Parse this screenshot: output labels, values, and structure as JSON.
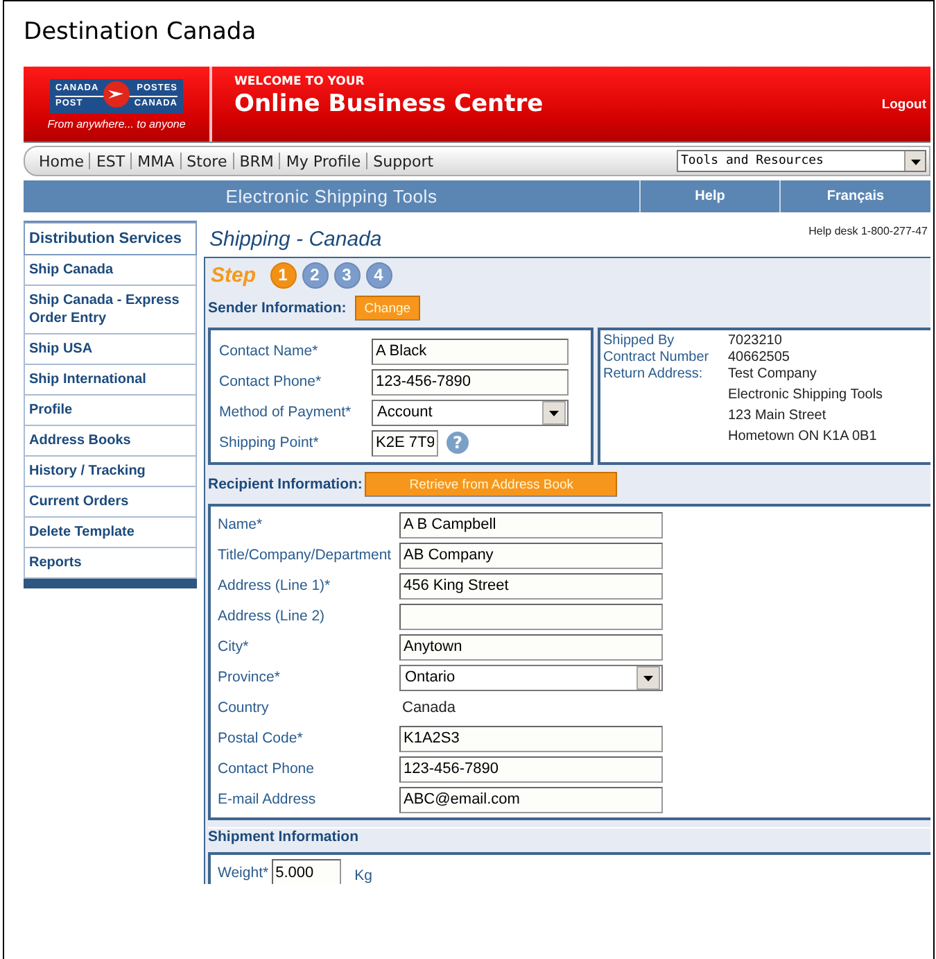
{
  "document_title": "Destination Canada",
  "header": {
    "logo": {
      "top_left": "CANADA",
      "top_right": "POSTES",
      "bottom_left": "POST",
      "bottom_right": "CANADA",
      "tagline": "From anywhere... to anyone"
    },
    "welcome": "WELCOME TO YOUR",
    "title": "Online Business Centre",
    "logout": "Logout"
  },
  "nav": {
    "links": [
      "Home",
      "EST",
      "MMA",
      "Store",
      "BRM",
      "My Profile",
      "Support"
    ],
    "tools_select": "Tools and Resources"
  },
  "blue_bar": {
    "title": "Electronic Shipping Tools",
    "links": [
      "Help",
      "Français"
    ]
  },
  "sidebar": {
    "heading": "Distribution Services",
    "items": [
      "Ship Canada",
      "Ship Canada - Express Order Entry",
      "Ship USA",
      "Ship International",
      "Profile",
      "Address Books",
      "History / Tracking",
      "Current Orders",
      "Delete Template",
      "Reports"
    ]
  },
  "page": {
    "title": "Shipping - Canada",
    "help_desk": "Help desk 1-800-277-47"
  },
  "steps": {
    "label": "Step",
    "items": [
      {
        "number": "1",
        "selected": true
      },
      {
        "number": "2",
        "selected": false
      },
      {
        "number": "3",
        "selected": false
      },
      {
        "number": "4",
        "selected": false
      }
    ]
  },
  "sender": {
    "heading": "Sender Information:",
    "button": "Change",
    "fields": [
      {
        "label": "Contact Name*",
        "kind": "text",
        "value": "A Black"
      },
      {
        "label": "Contact Phone*",
        "kind": "text",
        "value": "123-456-7890"
      },
      {
        "label": "Method of Payment*",
        "kind": "select",
        "value": "Account"
      },
      {
        "label": "Shipping Point*",
        "kind": "short",
        "value": "K2E 7T9",
        "help_icon": "?"
      }
    ],
    "info": [
      {
        "label": "Shipped By",
        "lines": [
          "7023210"
        ]
      },
      {
        "label": "Contract Number",
        "lines": [
          "40662505"
        ]
      },
      {
        "label": "Return Address:",
        "lines": [
          "Test Company",
          "Electronic Shipping Tools",
          "123 Main Street",
          "Hometown  ON  K1A 0B1"
        ]
      }
    ]
  },
  "recipient": {
    "heading": "Recipient Information:",
    "button": "Retrieve from Address Book",
    "fields": [
      {
        "label": "Name*",
        "kind": "text",
        "value": "A B Campbell"
      },
      {
        "label": "Title/Company/Department",
        "kind": "text",
        "value": "AB Company"
      },
      {
        "label": "Address (Line 1)*",
        "kind": "text",
        "value": "456 King Street"
      },
      {
        "label": "Address (Line 2)",
        "kind": "text"
      },
      {
        "label": "City*",
        "kind": "text",
        "value": "Anytown"
      },
      {
        "label": "Province*",
        "kind": "select",
        "value": "Ontario"
      },
      {
        "label": "Country",
        "kind": "static",
        "value": "Canada"
      },
      {
        "label": "Postal Code*",
        "kind": "text",
        "value": "K1A2S3"
      },
      {
        "label": "Contact Phone",
        "kind": "text",
        "value": "123-456-7890"
      },
      {
        "label": "E-mail Address",
        "kind": "text",
        "value": "ABC@email.com"
      }
    ]
  },
  "shipment": {
    "heading": "Shipment Information",
    "fields": [
      {
        "label": "Weight*",
        "value": "5.000",
        "unit": "Kg"
      }
    ]
  }
}
